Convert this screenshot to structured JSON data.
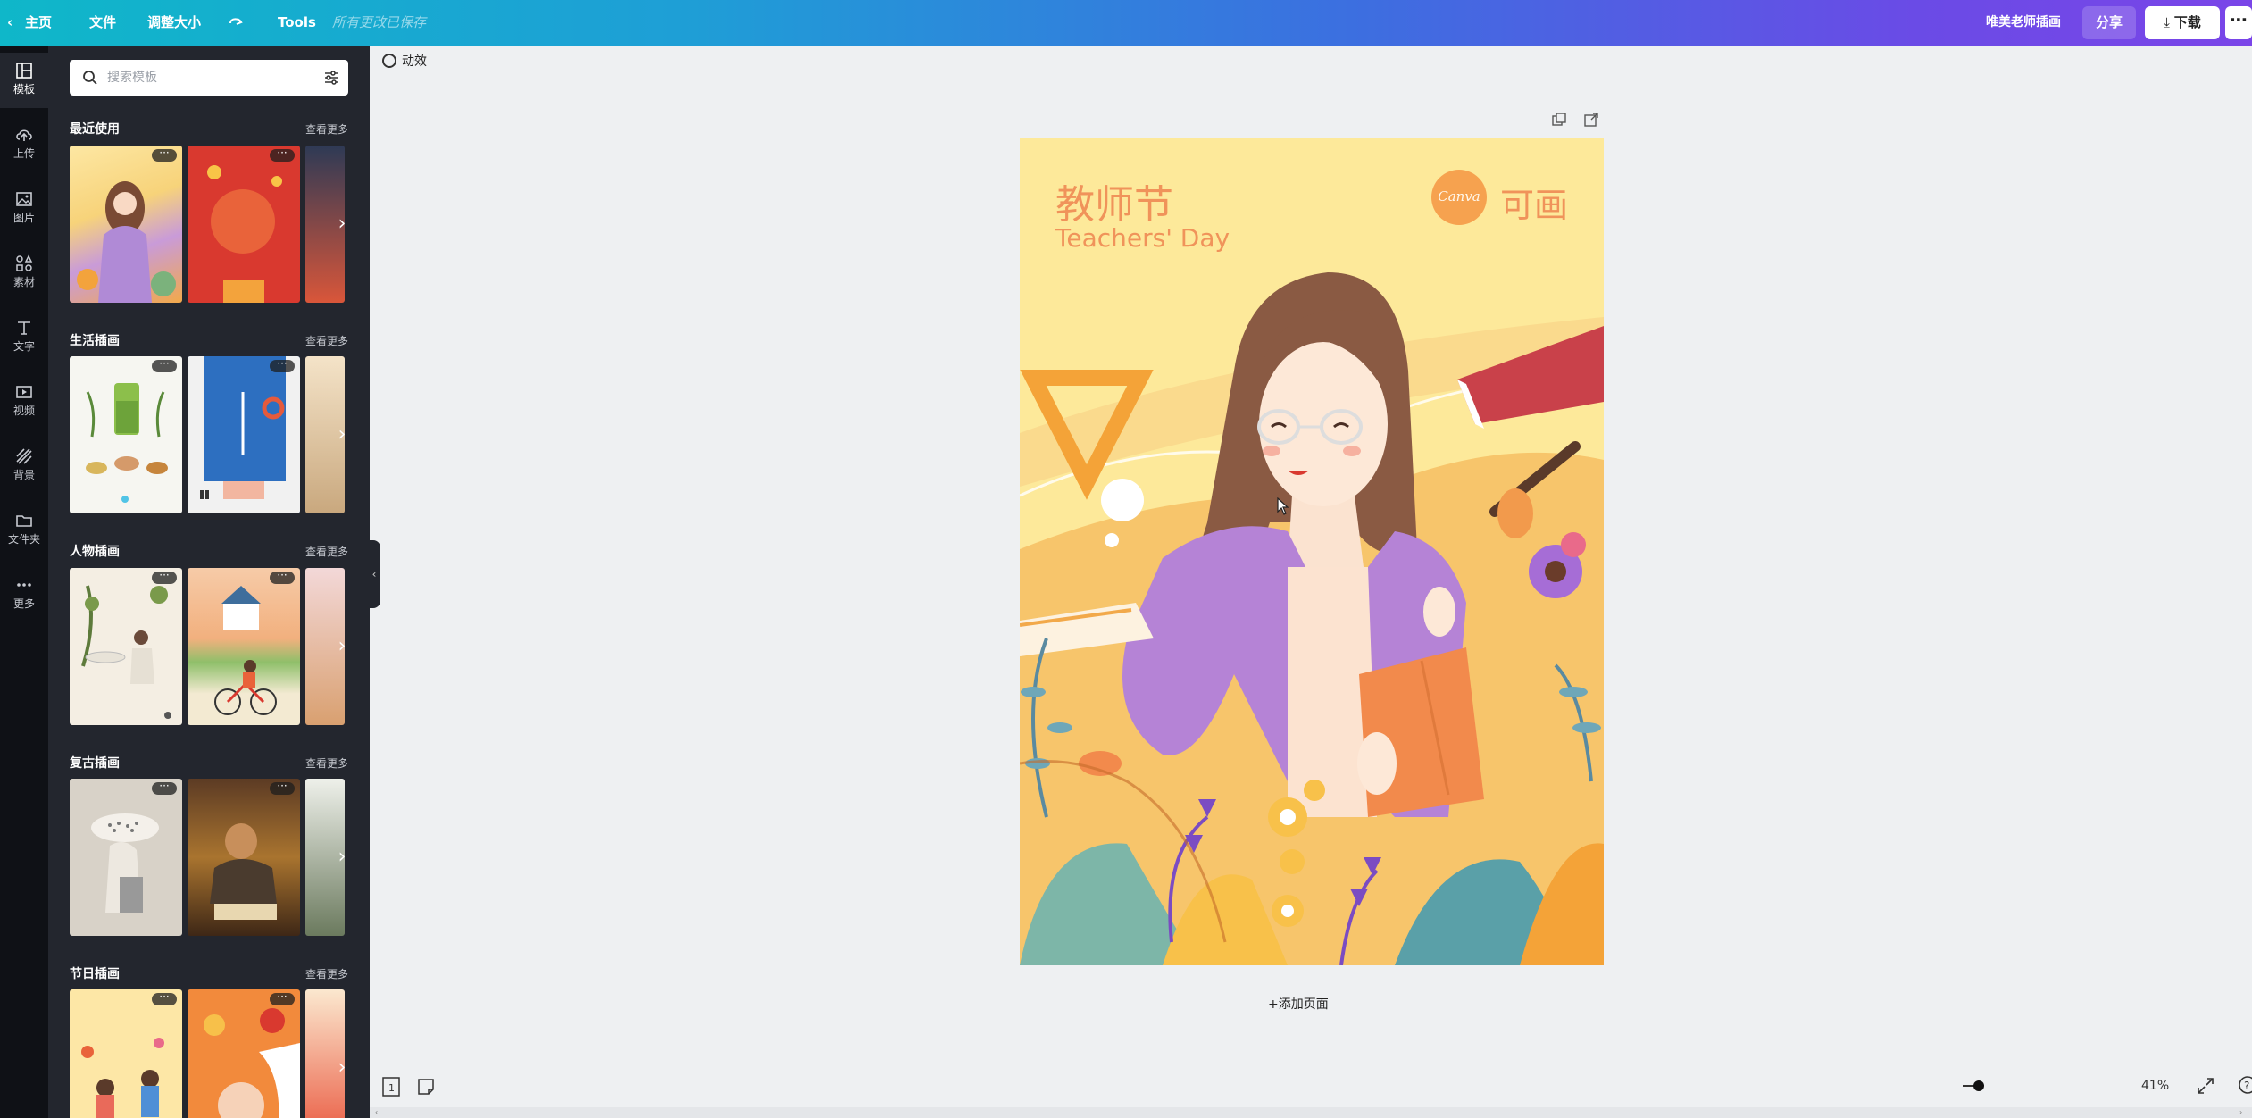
{
  "topbar": {
    "home": "主页",
    "file": "文件",
    "resize": "调整大小",
    "tools": "Tools",
    "saved_status": "所有更改已保存",
    "design_name": "唯美老师插画",
    "share": "分享",
    "download": "下载"
  },
  "rail": {
    "items": [
      {
        "label": "模板",
        "icon": "template-icon"
      },
      {
        "label": "上传",
        "icon": "upload-icon"
      },
      {
        "label": "图片",
        "icon": "photo-icon"
      },
      {
        "label": "素材",
        "icon": "elements-icon"
      },
      {
        "label": "文字",
        "icon": "text-icon"
      },
      {
        "label": "视频",
        "icon": "video-icon"
      },
      {
        "label": "背景",
        "icon": "background-icon"
      },
      {
        "label": "文件夹",
        "icon": "folder-icon"
      },
      {
        "label": "更多",
        "icon": "more-icon"
      }
    ]
  },
  "panel": {
    "search_placeholder": "搜索模板",
    "sections": [
      {
        "title": "最近使用",
        "more": "查看更多"
      },
      {
        "title": "生活插画",
        "more": "查看更多"
      },
      {
        "title": "人物插画",
        "more": "查看更多"
      },
      {
        "title": "复古插画",
        "more": "查看更多"
      },
      {
        "title": "节日插画",
        "more": "查看更多"
      }
    ]
  },
  "canvas": {
    "animate": "动效",
    "add_page": "+添加页面",
    "zoom": "41%",
    "page_title_cn": "教师节",
    "page_title_en": "Teachers' Day",
    "logo_text": "Canva",
    "logo_cn": "可画"
  },
  "colors": {
    "accent": "#7a45e8",
    "page_bg": "#fde99a",
    "title_color": "#f0935a"
  }
}
